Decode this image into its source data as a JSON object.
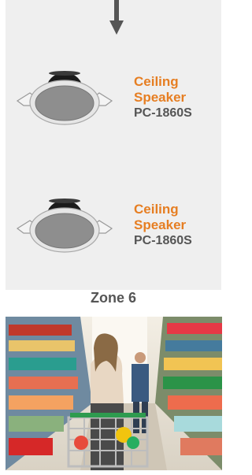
{
  "zone": {
    "label": "Zone 6"
  },
  "speakers": [
    {
      "name_line1": "Ceiling",
      "name_line2": "Speaker",
      "model": "PC-1860S"
    },
    {
      "name_line1": "Ceiling",
      "name_line2": "Speaker",
      "model": "PC-1860S"
    }
  ],
  "colors": {
    "accent": "#e67e22",
    "panel": "#efefef",
    "text": "#555555",
    "arrow": "#555555"
  },
  "icons": {
    "arrow": "arrow-down-icon",
    "speaker": "ceiling-speaker-icon"
  }
}
